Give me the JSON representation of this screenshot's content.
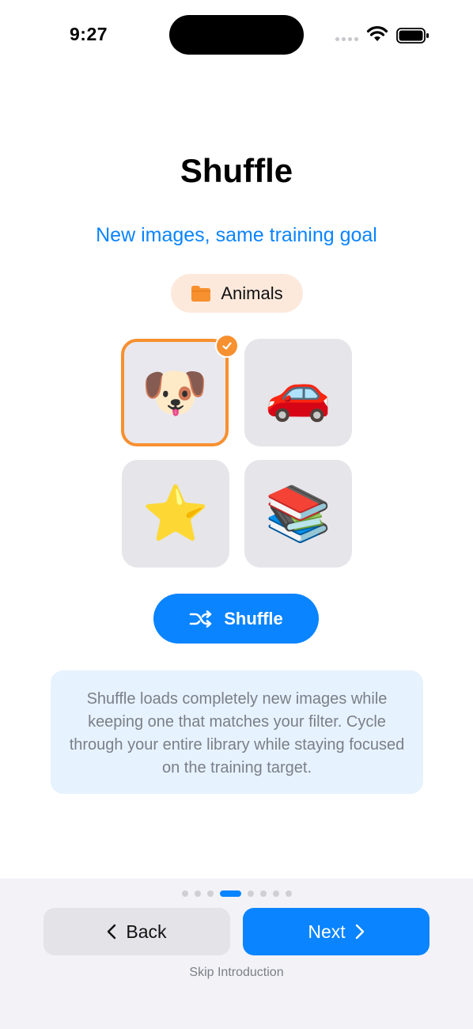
{
  "status_bar": {
    "time": "9:27"
  },
  "header": {
    "title": "Shuffle",
    "subtitle": "New images, same training goal"
  },
  "category": {
    "label": "Animals",
    "icon": "folder-icon",
    "color": "#f7902f"
  },
  "grid": {
    "tiles": [
      {
        "emoji": "🐶",
        "name": "dog",
        "selected": true
      },
      {
        "emoji": "🚗",
        "name": "car",
        "selected": false
      },
      {
        "emoji": "⭐",
        "name": "star",
        "selected": false
      },
      {
        "emoji": "📚",
        "name": "books",
        "selected": false
      }
    ]
  },
  "shuffle_button": {
    "label": "Shuffle",
    "icon": "shuffle-icon"
  },
  "info": {
    "text": "Shuffle loads completely new images while keeping one that matches your filter. Cycle through your entire library while staying focused on the training target."
  },
  "pagination": {
    "total": 8,
    "current": 4
  },
  "nav": {
    "back_label": "Back",
    "next_label": "Next",
    "skip_label": "Skip Introduction"
  },
  "colors": {
    "accent": "#0a84ff",
    "highlight": "#f7902f",
    "info_bg": "#e6f2fd"
  }
}
